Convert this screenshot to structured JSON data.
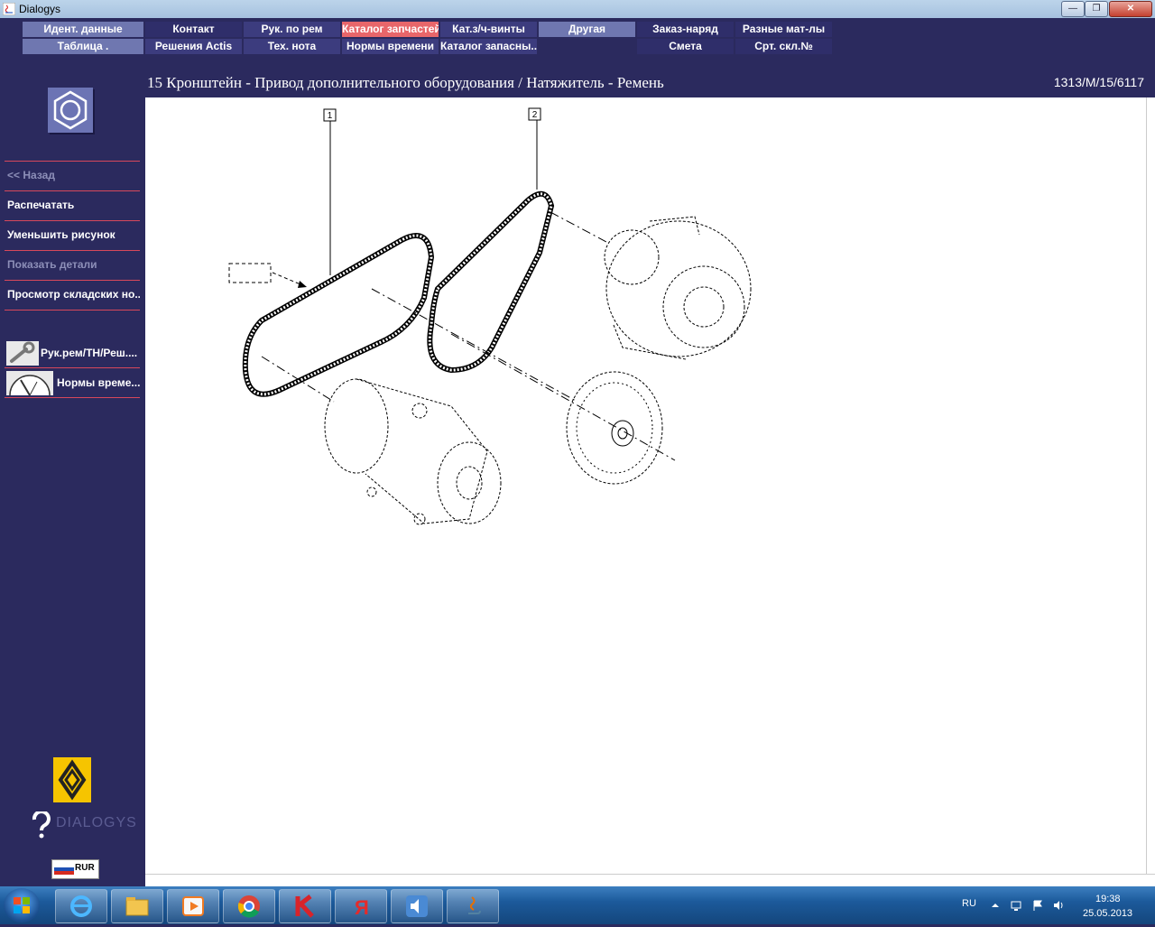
{
  "window": {
    "title": "Dialogys",
    "minimize_glyph": "—",
    "maximize_glyph": "❐",
    "close_glyph": "✕"
  },
  "menu": {
    "row1": [
      {
        "label": "Идент. данные",
        "style": "light"
      },
      {
        "label": "Контакт",
        "style": "dark"
      },
      {
        "label": "Рук. по рем",
        "style": "mid"
      },
      {
        "label": "Каталог запчастей",
        "style": "active"
      },
      {
        "label": "Кат.з/ч-винты",
        "style": "mid"
      },
      {
        "label": "Другая",
        "style": "light"
      },
      {
        "label": "Заказ-наряд",
        "style": "dark"
      },
      {
        "label": "Разные мат-лы",
        "style": "dark"
      }
    ],
    "row2": [
      {
        "label": "Таблица .",
        "style": "light"
      },
      {
        "label": "Решения Actis",
        "style": "mid"
      },
      {
        "label": "Тех. нота",
        "style": "mid"
      },
      {
        "label": "Нормы времени",
        "style": "mid"
      },
      {
        "label": "Каталог запасны...",
        "style": "mid"
      },
      {
        "label": "Смета",
        "style": "dark"
      },
      {
        "label": "Срт. скл.№",
        "style": "dark"
      }
    ]
  },
  "breadcrumb": "15 Кронштейн - Привод дополнительного оборудования / Натяжитель - Ремень",
  "doc_ref": "1313/M/15/6117",
  "sidebar": {
    "logo_icon": "hexagon-nut-icon",
    "items": [
      {
        "label": "<< Назад",
        "enabled": false
      },
      {
        "label": "Распечатать",
        "enabled": true
      },
      {
        "label": "Уменьшить рисунок",
        "enabled": true
      },
      {
        "label": "Показать детали",
        "enabled": false
      },
      {
        "label": "Просмотр складских но...",
        "enabled": true
      }
    ],
    "shortcuts": [
      {
        "label": "Рук.рем/ТН/Реш....",
        "icon": "wrench-icon"
      },
      {
        "label": "Нормы време...",
        "icon": "stopwatch-icon"
      }
    ],
    "brand": "DIALOGYS",
    "currency": "RUR"
  },
  "diagram": {
    "callouts": [
      "1",
      "2"
    ],
    "parts": [
      "belt-1",
      "belt-2",
      "alternator",
      "ac-compressor",
      "crankshaft-pulley"
    ]
  },
  "taskbar": {
    "apps": [
      "internet-explorer-icon",
      "explorer-icon",
      "media-player-icon",
      "chrome-icon",
      "kaspersky-icon",
      "yandex-icon",
      "speaker-app-icon",
      "java-icon"
    ],
    "language": "RU",
    "time": "19:38",
    "date": "25.05.2013"
  }
}
